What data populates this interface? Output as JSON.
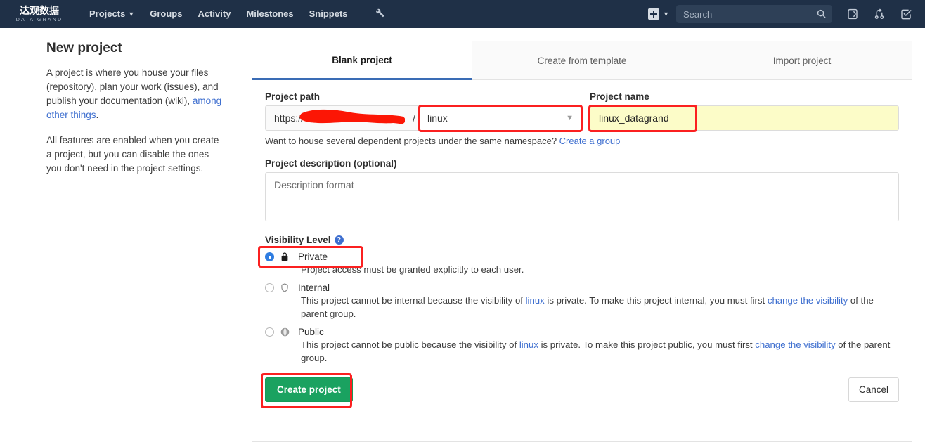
{
  "navbar": {
    "logo_cn": "达观数据",
    "logo_en": "DATA GRAND",
    "links": [
      {
        "label": "Projects",
        "has_caret": true
      },
      {
        "label": "Groups",
        "has_caret": false
      },
      {
        "label": "Activity",
        "has_caret": false
      },
      {
        "label": "Milestones",
        "has_caret": false
      },
      {
        "label": "Snippets",
        "has_caret": false
      }
    ],
    "wrench_icon": "wrench-icon",
    "plus_icon": "plus-square-icon",
    "plus_caret_icon": "chevron-down-icon",
    "search": {
      "value": "",
      "placeholder": "Search",
      "icon": "search-icon"
    },
    "icons": [
      {
        "name": "issues-icon"
      },
      {
        "name": "merge-requests-icon"
      },
      {
        "name": "todos-icon"
      }
    ],
    "bg_color": "#1f3047"
  },
  "aside": {
    "title": "New project",
    "paragraph1_pre": "A project is where you house your files (repository), plan your work (issues), and publish your documentation (wiki), ",
    "paragraph1_link": "among other things",
    "paragraph1_post": ".",
    "paragraph2": "All features are enabled when you create a project, but you can disable the ones you don't need in the project settings."
  },
  "tabs": [
    {
      "label": "Blank project",
      "active": true
    },
    {
      "label": "Create from template",
      "active": false
    },
    {
      "label": "Import project",
      "active": false
    }
  ],
  "form": {
    "project_path_label": "Project path",
    "path_prefix": "https://",
    "path_redacted": true,
    "path_slash": "/",
    "namespace_value": "linux",
    "namespace_caret": "chevron-down-icon",
    "project_name_label": "Project name",
    "project_name_value": "linux_datagrand",
    "project_name_placeholder": "",
    "hint_text": "Want to house several dependent projects under the same namespace? ",
    "hint_link": "Create a group",
    "description_label": "Project description (optional)",
    "description_value": "",
    "description_placeholder": "Description format",
    "visibility_label": "Visibility Level",
    "visibility_help_icon": "question-mark-icon",
    "visibility_options": [
      {
        "name": "Private",
        "icon": "lock-icon",
        "selected": true,
        "desc_pre": "Project access must be granted explicitly to each user.",
        "desc_link1": "",
        "desc_mid": "",
        "desc_link2": "",
        "desc_post": ""
      },
      {
        "name": "Internal",
        "icon": "shield-icon",
        "selected": false,
        "desc_pre": "This project cannot be internal because the visibility of ",
        "desc_link1": "linux",
        "desc_mid": " is private. To make this project internal, you must first ",
        "desc_link2": "change the visibility",
        "desc_post": " of the parent group."
      },
      {
        "name": "Public",
        "icon": "globe-icon",
        "selected": false,
        "desc_pre": "This project cannot be public because the visibility of ",
        "desc_link1": "linux",
        "desc_mid": " is private. To make this project public, you must first ",
        "desc_link2": "change the visibility",
        "desc_post": " of the parent group."
      }
    ],
    "create_button": "Create project",
    "cancel_button": "Cancel"
  },
  "annotations": {
    "color": "#fb2020",
    "redaction_color": "#fc1605",
    "boxes": [
      "namespace-select",
      "project-name-field",
      "private-option",
      "create-project-button"
    ]
  }
}
